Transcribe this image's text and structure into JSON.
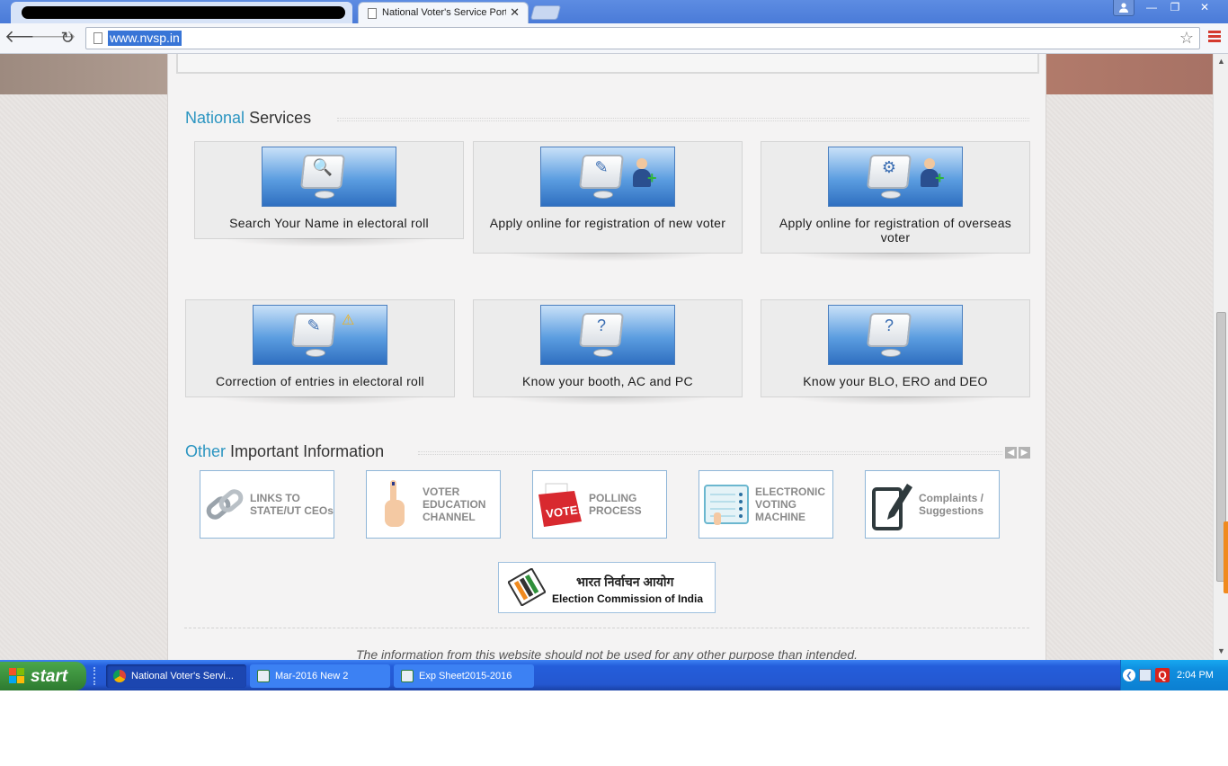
{
  "browser": {
    "active_tab_title": "National Voter's Service Port",
    "tab_close_glyph": "✕",
    "url": "www.nvsp.in",
    "window_controls": {
      "minimize": "—",
      "maximize": "❐",
      "close": "✕"
    }
  },
  "page": {
    "national_services": {
      "title_accent": "National",
      "title_rest": "Services",
      "cards": [
        {
          "label": "Search Your Name in electoral roll",
          "icon": "search-monitor-icon"
        },
        {
          "label": "Apply online for registration of new voter",
          "icon": "new-voter-icon"
        },
        {
          "label": "Apply online for registration of overseas voter",
          "icon": "overseas-voter-icon"
        },
        {
          "label": "Correction of entries in electoral roll",
          "icon": "correction-icon"
        },
        {
          "label": "Know your booth, AC and PC",
          "icon": "booth-info-icon"
        },
        {
          "label": "Know your BLO, ERO and DEO",
          "icon": "officer-info-icon"
        }
      ]
    },
    "other_info": {
      "title_accent": "Other",
      "title_rest": "Important Information",
      "cards": [
        {
          "label": "LINKS TO STATE/UT CEOs",
          "icon": "chain-link-icon"
        },
        {
          "label": "VOTER EDUCATION CHANNEL",
          "icon": "inked-finger-icon"
        },
        {
          "label": "POLLING PROCESS",
          "icon": "vote-box-icon"
        },
        {
          "label": "ELECTRONIC VOTING MACHINE",
          "icon": "evm-icon"
        },
        {
          "label": "Complaints / Suggestions",
          "icon": "pencil-note-icon"
        }
      ]
    },
    "eci": {
      "hindi": "भारत निर्वाचन आयोग",
      "english": "Election Commission of India"
    },
    "disclaimer": "The information from this website should not be used for any other purpose than intended."
  },
  "taskbar": {
    "start": "start",
    "tasks": [
      {
        "label": "National Voter's Servi...",
        "active": true
      },
      {
        "label": "Mar-2016 New 2",
        "active": false
      },
      {
        "label": "Exp Sheet2015-2016",
        "active": false
      }
    ],
    "clock": "2:04 PM"
  },
  "colors": {
    "section_accent": "#2b95c1",
    "taskbar_blue": "#245edb",
    "start_green": "#3a8d3b",
    "url_selection": "#3875d7"
  }
}
